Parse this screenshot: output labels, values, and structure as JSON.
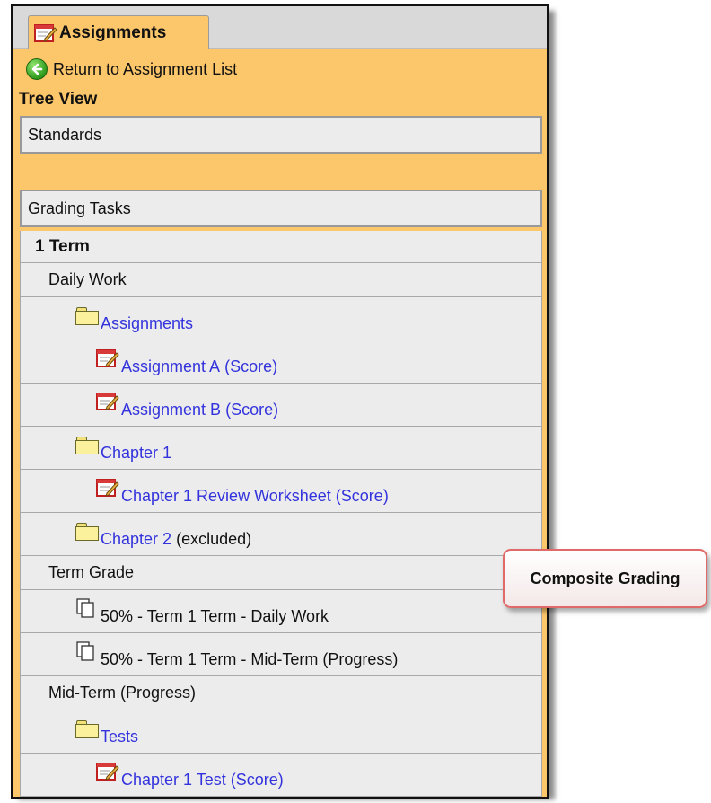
{
  "tab": {
    "label": "Assignments",
    "icon": "assignment-icon"
  },
  "return_link": {
    "label": "Return to Assignment List",
    "icon": "back-arrow-icon"
  },
  "tree_title": "Tree View",
  "standards_header": "Standards",
  "grading_tasks_header": "Grading Tasks",
  "tree": {
    "term": "1 Term",
    "daily_work": "Daily Work",
    "assignments_folder": "Assignments",
    "assignment_a": {
      "name": "Assignment A",
      "score": "(Score)"
    },
    "assignment_b": {
      "name": "Assignment B",
      "score": "(Score)"
    },
    "chapter1_folder": "Chapter 1",
    "chapter1_review": {
      "name": "Chapter 1 Review Worksheet",
      "score": "(Score)"
    },
    "chapter2_folder": {
      "name": "Chapter 2",
      "note": "(excluded)"
    },
    "term_grade": "Term Grade",
    "composite_1": "50% - Term 1 Term - Daily Work",
    "composite_2": "50% - Term 1 Term - Mid-Term (Progress)",
    "mid_term": "Mid-Term (Progress)",
    "tests_folder": "Tests",
    "chapter1_test": {
      "name": "Chapter 1 Test",
      "score": "(Score)"
    }
  },
  "callout": "Composite Grading",
  "colors": {
    "panel_bg": "#fcc66a",
    "row_bg": "#ececec",
    "link": "#3333dd",
    "callout_border": "#e06a6a"
  }
}
